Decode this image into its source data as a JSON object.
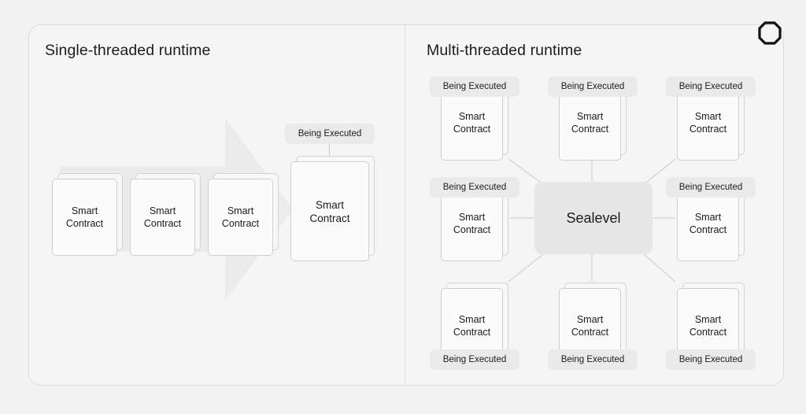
{
  "brand": {
    "logo_icon": "octagon-outline-logo"
  },
  "panels": {
    "left": {
      "title": "Single-threaded runtime",
      "arrow_icon": "right-block-arrow",
      "queue": [
        {
          "label": "Smart\nContract"
        },
        {
          "label": "Smart\nContract"
        },
        {
          "label": "Smart\nContract"
        }
      ],
      "active": {
        "label": "Smart\nContract",
        "badge": "Being Executed"
      }
    },
    "right": {
      "title": "Multi-threaded runtime",
      "center": {
        "label": "Sealevel"
      },
      "nodes": [
        {
          "id": "top-left",
          "label": "Smart\nContract",
          "badge": "Being Executed",
          "badge_position": "top"
        },
        {
          "id": "top-center",
          "label": "Smart\nContract",
          "badge": "Being Executed",
          "badge_position": "top"
        },
        {
          "id": "top-right",
          "label": "Smart\nContract",
          "badge": "Being Executed",
          "badge_position": "top"
        },
        {
          "id": "middle-left",
          "label": "Smart\nContract",
          "badge": "Being Executed",
          "badge_position": "top"
        },
        {
          "id": "middle-right",
          "label": "Smart\nContract",
          "badge": "Being Executed",
          "badge_position": "top"
        },
        {
          "id": "bottom-left",
          "label": "Smart\nContract",
          "badge": "Being Executed",
          "badge_position": "bottom"
        },
        {
          "id": "bottom-center",
          "label": "Smart\nContract",
          "badge": "Being Executed",
          "badge_position": "bottom"
        },
        {
          "id": "bottom-right",
          "label": "Smart\nContract",
          "badge": "Being Executed",
          "badge_position": "bottom"
        }
      ]
    }
  },
  "colors": {
    "page_background": "#f2f2f2",
    "panel_background": "#f5f5f5",
    "card_fill": "#fbfbfb",
    "card_border": "#cfcfcf",
    "badge_fill": "#eaeaea",
    "center_fill": "#e6e6e6",
    "arrow_fill": "#ebebeb",
    "connector": "#c9c9c9",
    "text": "#1c1c1c"
  }
}
